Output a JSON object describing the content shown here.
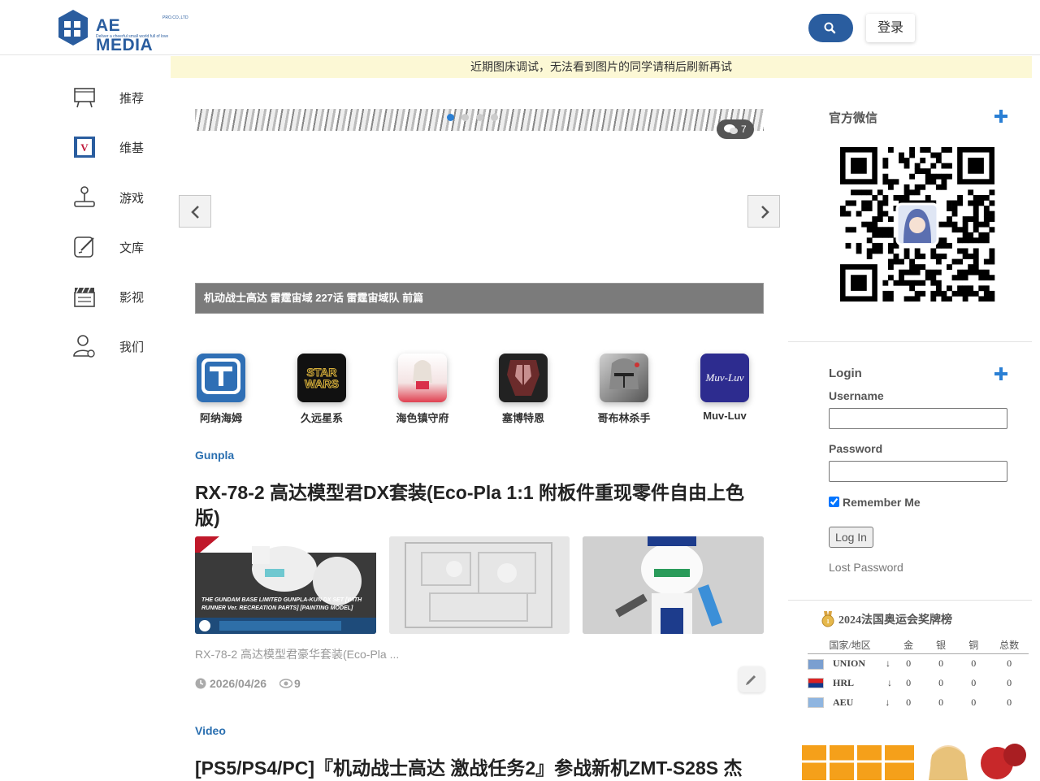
{
  "header": {
    "logo_text": "AE MEDIA",
    "logo_sub": "Deliver a cheerful small world full of love",
    "logo_tag": "PRO.CO.,LTD",
    "login_label": "登录"
  },
  "notice": "近期图床调试，无法看到图片的同学请稍后刷新再试",
  "sidebar": {
    "items": [
      {
        "label": "推荐",
        "icon": "easel-icon"
      },
      {
        "label": "维基",
        "icon": "wiki-icon"
      },
      {
        "label": "游戏",
        "icon": "joystick-icon"
      },
      {
        "label": "文库",
        "icon": "edit-note-icon"
      },
      {
        "label": "影视",
        "icon": "clapperboard-icon"
      },
      {
        "label": "我们",
        "icon": "user-icon"
      }
    ]
  },
  "carousel": {
    "caption": "机动战士高达 雷霆宙域 227话 雷霆宙域队 前篇",
    "comment_count": "7",
    "active_dot": 0,
    "dot_count": 4
  },
  "categories": [
    {
      "label": "阿纳海姆",
      "color": "#2f6fb5"
    },
    {
      "label": "久远星系",
      "color": "#111111"
    },
    {
      "label": "海色镇守府",
      "color": "#f3d7d7"
    },
    {
      "label": "塞博特恩",
      "color": "#5a2020"
    },
    {
      "label": "哥布林杀手",
      "color": "#777777"
    },
    {
      "label": "Muv-Luv",
      "color": "#2d2c8f"
    }
  ],
  "articles": [
    {
      "category": "Gunpla",
      "title": "RX-78-2 高达模型君DX套装(Eco-Pla 1:1 附板件重现零件自由上色版)",
      "excerpt": "RX-78-2 高达模型君豪华套装(Eco-Pla ...",
      "date": "2026/04/26",
      "views": "9",
      "thumb1_caption": "THE GUNDAM BASE LIMITED GUNPLA-KUN DX SET [WITH RUNNER Ver. RECREATION PARTS] [PAINTING MODEL]"
    },
    {
      "category": "Video",
      "title": "[PS5/PS4/PC]『机动战士高达 激战任务2』参战新机ZMT-S28S 杰"
    }
  ],
  "right": {
    "wechat_title": "官方微信",
    "login_title": "Login",
    "username_label": "Username",
    "password_label": "Password",
    "remember_label": "Remember Me",
    "submit_label": "Log In",
    "lost_password": "Lost Password",
    "medal_title": "2024法国奥运会奖牌榜",
    "medal_headers": [
      "国家/地区",
      "金",
      "银",
      "铜",
      "总数"
    ],
    "medal_rows": [
      {
        "name": "UNION",
        "arrow": "↓",
        "gold": "0",
        "silver": "0",
        "bronze": "0",
        "total": "0"
      },
      {
        "name": "HRL",
        "arrow": "↓",
        "gold": "0",
        "silver": "0",
        "bronze": "0",
        "total": "0"
      },
      {
        "name": "AEU",
        "arrow": "↓",
        "gold": "0",
        "silver": "0",
        "bronze": "0",
        "total": "0"
      }
    ]
  },
  "colors": {
    "brand": "#2a5d9f",
    "link": "#2a6fb0",
    "notice_bg": "#fcf8d5",
    "plus": "#2a7fd4"
  }
}
